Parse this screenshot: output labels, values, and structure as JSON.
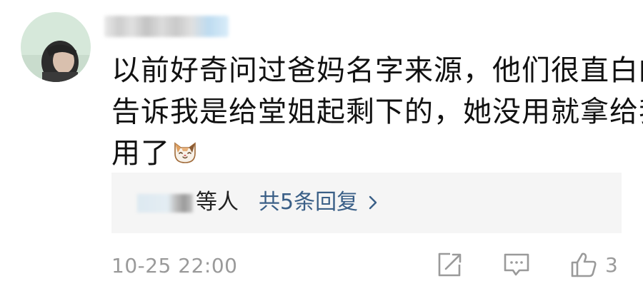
{
  "comment": {
    "lines": [
      "以前好奇问过爸妈名字来源，他们很直白的",
      "告诉我是给堂姐起剩下的，她没用就拿给我",
      "用了"
    ],
    "emoji": "cat-face-emoji"
  },
  "replies": {
    "names_suffix": "等人",
    "link_label": "共5条回复",
    "link_icon": "chevron-right-icon",
    "link_color": "#3a5f87"
  },
  "meta": {
    "timestamp": "10-25 22:00",
    "like_count": "3"
  },
  "icons": {
    "share": "share-icon",
    "reply": "comment-icon",
    "like": "thumbs-up-icon"
  },
  "colors": {
    "text": "#111111",
    "muted": "#9a9a9a",
    "reply_bg": "#f5f5f5"
  }
}
